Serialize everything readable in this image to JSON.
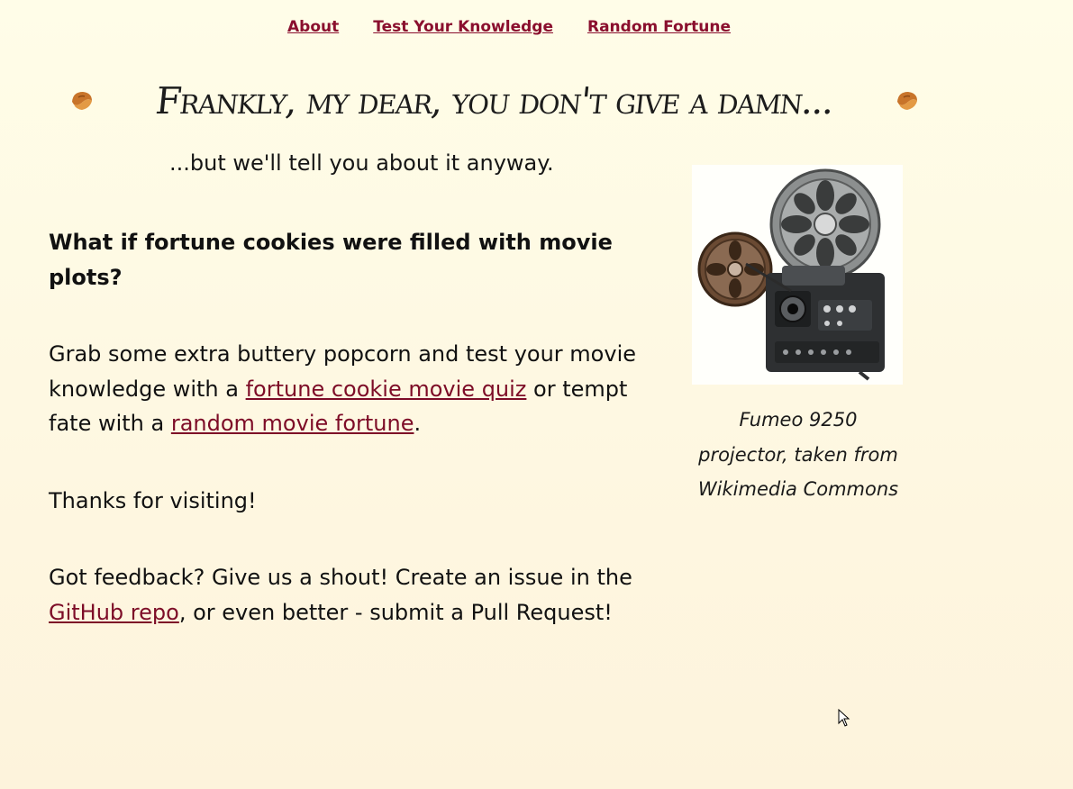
{
  "nav": {
    "items": [
      {
        "label": "About"
      },
      {
        "label": "Test Your Knowledge"
      },
      {
        "label": "Random Fortune"
      }
    ]
  },
  "header": {
    "title": "Frankly, my dear, you don't give a damn...",
    "subtitle": "...but we'll tell you about it anyway.",
    "left_icon": "fortune-cookie-icon",
    "right_icon": "fortune-cookie-icon"
  },
  "main": {
    "question": "What if fortune cookies were filled with movie plots?",
    "intro": {
      "before": "Grab some extra buttery popcorn and test your movie knowledge with a ",
      "quiz_link": "fortune cookie movie quiz",
      "middle": " or tempt fate with a ",
      "fortune_link": "random movie fortune",
      "after": "."
    },
    "thanks": "Thanks for visiting!",
    "feedback": {
      "before": "Got feedback? Give us a shout! Create an issue in the ",
      "repo_link": "GitHub repo",
      "after": ", or even better - submit a Pull Request!"
    }
  },
  "figure": {
    "image": "film-projector-image",
    "caption": "Fumeo 9250 projector, taken from Wikimedia Commons"
  },
  "colors": {
    "link": "#8a0f2e",
    "background_top": "#fffde8",
    "background_bottom": "#fdf3dc"
  }
}
